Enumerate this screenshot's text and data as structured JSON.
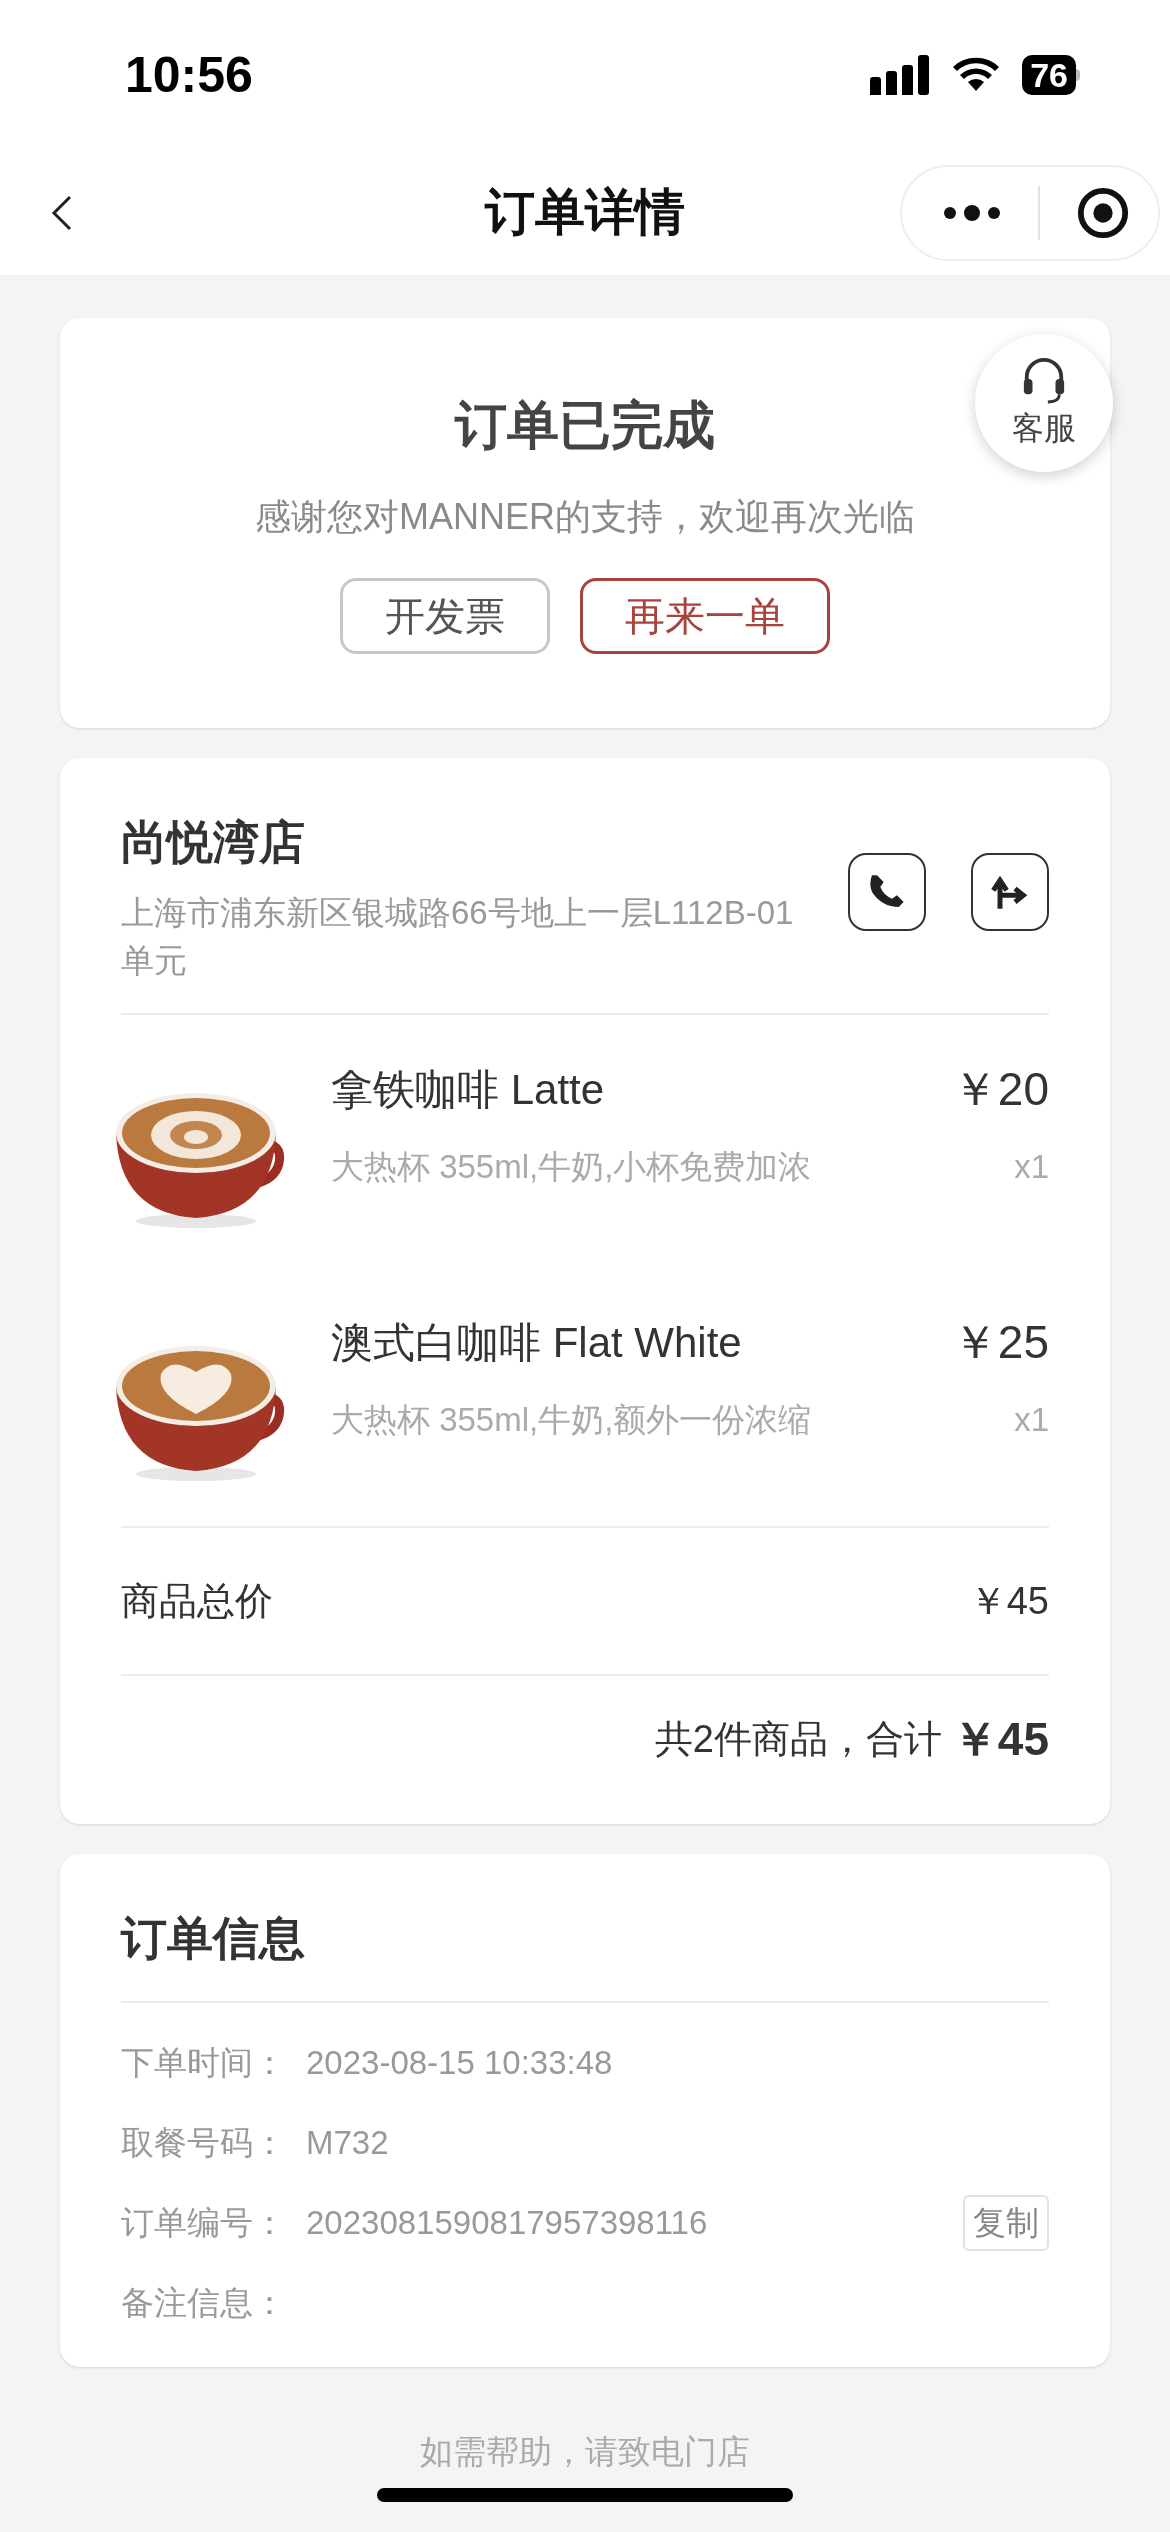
{
  "status_bar": {
    "time": "10:56",
    "battery": "76"
  },
  "nav": {
    "title": "订单详情"
  },
  "status_card": {
    "title": "订单已完成",
    "message": "感谢您对MANNER的支持，欢迎再次光临",
    "buttons": [
      {
        "label": "开发票",
        "kind": "plain"
      },
      {
        "label": "再来一单",
        "kind": "primary"
      }
    ],
    "service": {
      "label": "客服"
    }
  },
  "store": {
    "name": "尚悦湾店",
    "address": "上海市浦东新区银城路66号地上一层L112B-01单元",
    "items": [
      {
        "name": "拿铁咖啡 Latte",
        "price": "￥20",
        "options": "大热杯 355ml,牛奶,小杯免费加浓",
        "quantity": "x1"
      },
      {
        "name": "澳式白咖啡 Flat White",
        "price": "￥25",
        "options": "大热杯 355ml,牛奶,额外一份浓缩",
        "quantity": "x1"
      }
    ],
    "subtotal": {
      "label": "商品总价",
      "value": "￥45"
    },
    "total": {
      "label": "共2件商品，合计",
      "value": "￥45"
    }
  },
  "order_info": {
    "title": "订单信息",
    "rows": [
      {
        "label": "下单时间：",
        "value": "2023-08-15 10:33:48"
      },
      {
        "label": "取餐号码：",
        "value": "M732"
      },
      {
        "label": "订单编号：",
        "value": "2023081590817957398116",
        "action": "复制"
      },
      {
        "label": "备注信息："
      }
    ]
  },
  "footer": "如需帮助，请致电门店"
}
